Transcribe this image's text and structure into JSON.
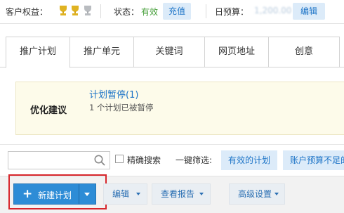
{
  "topbar": {
    "rights_label": "客户权益：",
    "status_label": "状态：",
    "status_value": "有效",
    "recharge_button": "充值",
    "budget_label": "日预算：",
    "budget_value": "1,200.00",
    "edit_button": "编辑"
  },
  "tabs": [
    "推广计划",
    "推广单元",
    "关键词",
    "网页地址",
    "创意"
  ],
  "suggestion": {
    "title": "优化建议",
    "link": "计划暂停(1)",
    "desc": "1 个计划已被暂停"
  },
  "filter": {
    "search_value": "",
    "checkbox_label": "精确搜索",
    "quick_filter_label": "一键筛选:",
    "chips": [
      "有效的计划",
      "账户预算不足的"
    ]
  },
  "toolbar": {
    "new_plan": "新建计划",
    "edit": "编辑",
    "report": "查看报告",
    "advanced": "高级设置"
  },
  "colors": {
    "accent": "#2d8cd6",
    "status_green": "#4aa13e",
    "link_blue": "#1d74c7",
    "highlight_red": "#d7262c"
  }
}
